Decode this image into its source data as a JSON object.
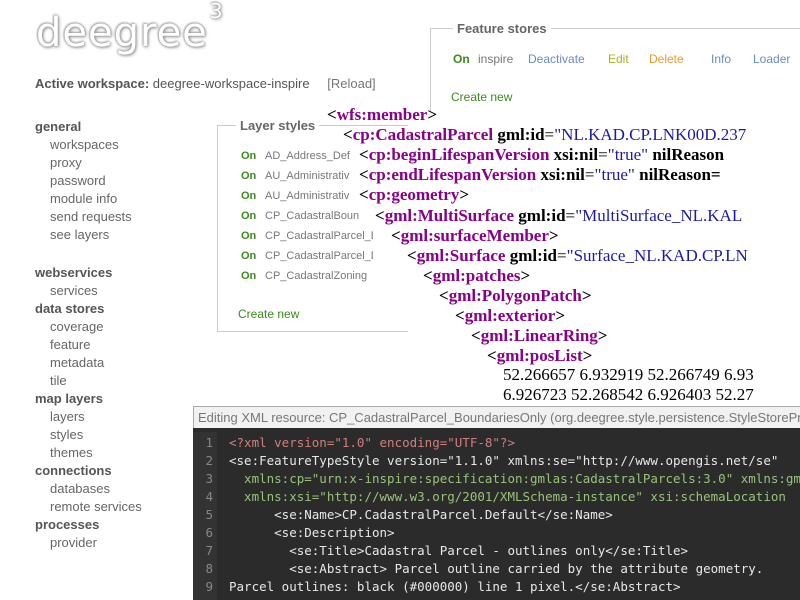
{
  "logo": {
    "text": "deegree",
    "sup": "3"
  },
  "workspace": {
    "label": "Active workspace:",
    "name": "deegree-workspace-inspire",
    "reload": "[Reload]"
  },
  "nav": {
    "general": {
      "title": "general",
      "items": [
        "workspaces",
        "proxy",
        "password",
        "module info",
        "send requests",
        "see layers"
      ]
    },
    "webservices": {
      "title": "webservices",
      "items": [
        "services"
      ]
    },
    "datastores": {
      "title": "data stores",
      "items": [
        "coverage",
        "feature",
        "metadata",
        "tile"
      ]
    },
    "maplayers": {
      "title": "map layers",
      "items": [
        "layers",
        "styles",
        "themes"
      ]
    },
    "connections": {
      "title": "connections",
      "items": [
        "databases",
        "remote services"
      ]
    },
    "processes": {
      "title": "processes",
      "items": [
        "provider"
      ]
    }
  },
  "feature_stores": {
    "title": "Feature stores",
    "row": {
      "status": "On",
      "name": "inspire",
      "deactivate": "Deactivate",
      "edit": "Edit",
      "delete": "Delete",
      "info": "Info",
      "loader": "Loader"
    },
    "create": "Create new",
    "colors": {
      "edit": "#a8b31e",
      "delete": "#e89a2a",
      "info": "#6a8ac8"
    }
  },
  "layer_styles": {
    "title": "Layer styles",
    "rows": [
      {
        "status": "On",
        "name": "AD_Address_Def"
      },
      {
        "status": "On",
        "name": "AU_Administrativ"
      },
      {
        "status": "On",
        "name": "AU_Administrativ"
      },
      {
        "status": "On",
        "name": "CP_CadastralBoun"
      },
      {
        "status": "On",
        "name": "CP_CadastralParcel_B"
      },
      {
        "status": "On",
        "name": "CP_CadastralParcel_Defe"
      },
      {
        "status": "On",
        "name": "CP_CadastralZoning"
      }
    ],
    "create": "Create new"
  },
  "xml_overlay": {
    "l1": "wfs:member",
    "l2_tag": "cp:CadastralParcel",
    "l2_attr": "gml:id",
    "l2_val": "\"NL.KAD.CP.LNK00D.237",
    "l3_tag": "cp:beginLifespanVersion",
    "l3_a1": "xsi:nil",
    "l3_v1": "\"true\"",
    "l3_a2": "nilReason",
    "l4_tag": "cp:endLifespanVersion",
    "l4_a1": "xsi:nil",
    "l4_v1": "\"true\"",
    "l4_a2": "nilReason=",
    "l5": "cp:geometry",
    "l6_tag": "gml:MultiSurface",
    "l6_attr": "gml:id",
    "l6_val": "\"MultiSurface_NL.KAL",
    "l7": "gml:surfaceMember",
    "l8_tag": "gml:Surface",
    "l8_attr": "gml:id",
    "l8_val": "\"Surface_NL.KAD.CP.LN",
    "l9": "gml:patches",
    "l10": "gml:PolygonPatch",
    "l11": "gml:exterior",
    "l12": "gml:LinearRing",
    "l13": "gml:posList",
    "l14": "52.266657 6.932919 52.266749 6.93",
    "l15": "6.926723 52.268542 6.926403 52.27"
  },
  "editor": {
    "title": "Editing XML resource: CP_CadastralParcel_BoundariesOnly (org.deegree.style.persistence.StyleStoreProvider)",
    "lines": [
      {
        "n": "1",
        "t": "<?xml version=\"1.0\" encoding=\"UTF-8\"?>"
      },
      {
        "n": "2",
        "t": "<se:FeatureTypeStyle version=\"1.1.0\" xmlns:se=\"http://www.opengis.net/se\""
      },
      {
        "n": "3",
        "t": "  xmlns:cp=\"urn:x-inspire:specification:gmlas:CadastralParcels:3.0\" xmlns:gml"
      },
      {
        "n": "4",
        "t": "  xmlns:xsi=\"http://www.w3.org/2001/XMLSchema-instance\" xsi:schemaLocation"
      },
      {
        "n": "5",
        "t": "      <se:Name>CP.CadastralParcel.Default</se:Name>"
      },
      {
        "n": "6",
        "t": "      <se:Description>"
      },
      {
        "n": "7",
        "t": "        <se:Title>Cadastral Parcel - outlines only</se:Title>"
      },
      {
        "n": "8",
        "t": "        <se:Abstract> Parcel outline carried by the attribute geometry."
      },
      {
        "n": "9",
        "t": "Parcel outlines: black (#000000) line 1 pixel.</se:Abstract>"
      }
    ]
  }
}
